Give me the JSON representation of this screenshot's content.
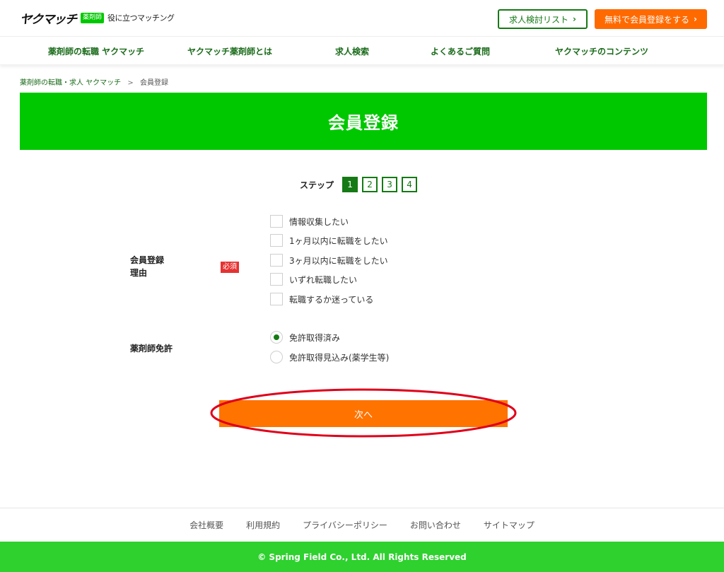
{
  "header": {
    "logo_text": "ヤクマッチ",
    "logo_badge": "薬剤師",
    "logo_tagline": "役に立つマッチング",
    "list_button": "求人検討リスト",
    "register_button": "無料で会員登録をする"
  },
  "nav": {
    "items": [
      {
        "label": "薬剤師の転職 ヤクマッチ"
      },
      {
        "label": "ヤクマッチ薬剤師とは"
      },
      {
        "label": "求人検索"
      },
      {
        "label": "よくあるご質問"
      },
      {
        "label": "ヤクマッチのコンテンツ"
      }
    ]
  },
  "breadcrumb": {
    "home": "薬剤師の転職・求人 ヤクマッチ",
    "separator": ">",
    "current": "会員登録"
  },
  "page_title": "会員登録",
  "steps": {
    "label": "ステップ",
    "items": [
      "1",
      "2",
      "3",
      "4"
    ],
    "active": 1
  },
  "form": {
    "reason": {
      "label_line1": "会員登録",
      "label_line2": "理由",
      "required": "必須",
      "options": [
        {
          "label": "情報収集したい",
          "checked": false
        },
        {
          "label": "1ヶ月以内に転職をしたい",
          "checked": false
        },
        {
          "label": "3ヶ月以内に転職をしたい",
          "checked": false
        },
        {
          "label": "いずれ転職したい",
          "checked": false
        },
        {
          "label": "転職するか迷っている",
          "checked": false
        }
      ]
    },
    "license": {
      "label": "薬剤師免許",
      "options": [
        {
          "label": "免許取得済み",
          "selected": true
        },
        {
          "label": "免許取得見込み(薬学生等)",
          "selected": false
        }
      ]
    },
    "next_button": "次へ"
  },
  "footer": {
    "links": [
      "会社概要",
      "利用規約",
      "プライバシーポリシー",
      "お問い合わせ",
      "サイトマップ"
    ],
    "copyright": "© Spring Field Co., Ltd. All Rights Reserved"
  },
  "colors": {
    "brand_green": "#00c800",
    "dark_green": "#157a15",
    "accent_orange": "#ff6a00",
    "required_red": "#e63232",
    "annotation_red": "#e0001a"
  }
}
